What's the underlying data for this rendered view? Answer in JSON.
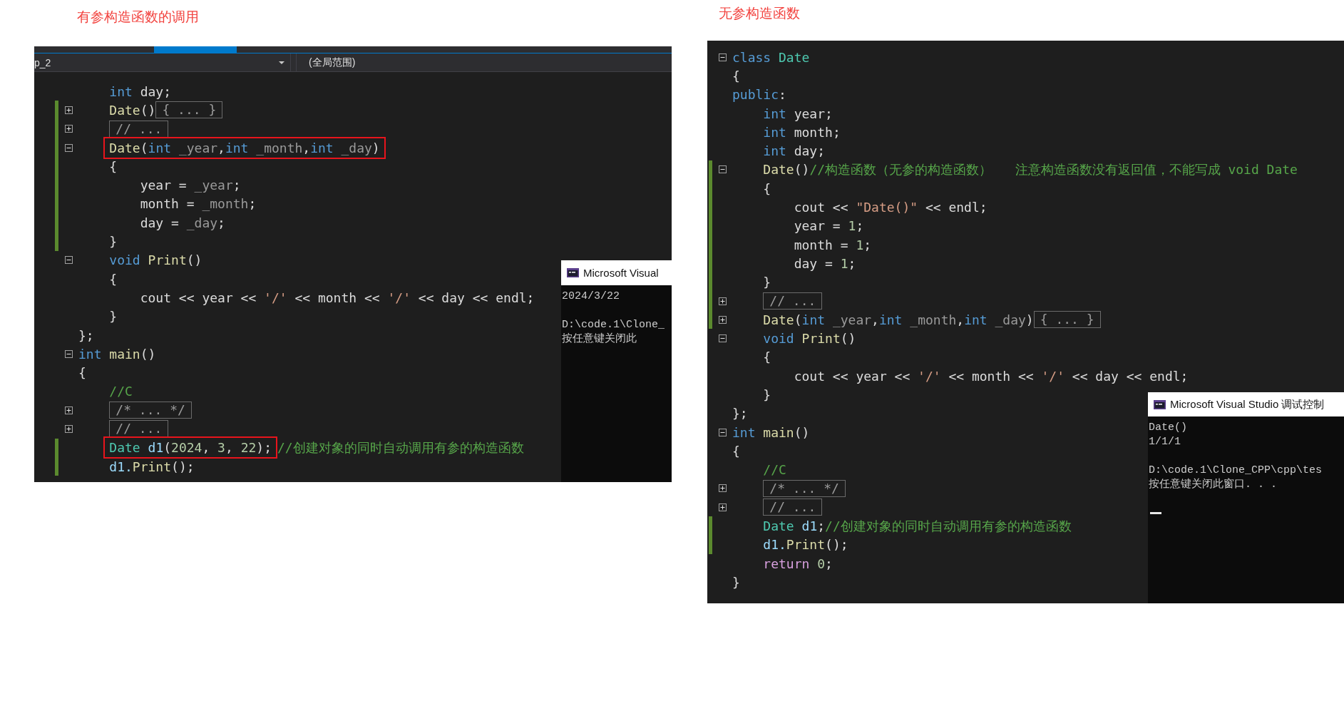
{
  "panels": [
    {
      "heading": "有参构造函数的调用",
      "nav": {
        "project": "p_2",
        "scope": "(全局范围)"
      },
      "lines": [
        {
          "changed": false,
          "parts": [
            {
              "kind": "indent"
            },
            {
              "kind": "code",
              "tokens": [
                {
                  "kind": "kw",
                  "text": "int"
                },
                {
                  "kind": "plain",
                  "text": " day;"
                }
              ]
            }
          ]
        },
        {
          "expanded": false,
          "changed": true,
          "parts": [
            {
              "kind": "indent"
            },
            {
              "kind": "code",
              "tokens": [
                {
                  "kind": "fn",
                  "text": "Date"
                },
                {
                  "kind": "plain",
                  "text": "()"
                }
              ]
            },
            {
              "kind": "fold",
              "text": "{ ... }"
            }
          ]
        },
        {
          "expanded": false,
          "changed": true,
          "parts": [
            {
              "kind": "indent"
            },
            {
              "kind": "fold",
              "text": "// ..."
            }
          ]
        },
        {
          "expanded": true,
          "changed": true,
          "parts": [
            {
              "kind": "indent"
            },
            {
              "kind": "marked",
              "tokens": [
                {
                  "kind": "fn",
                  "text": "Date"
                },
                {
                  "kind": "plain",
                  "text": "("
                },
                {
                  "kind": "kw",
                  "text": "int"
                },
                {
                  "kind": "param",
                  "text": " _year"
                },
                {
                  "kind": "plain",
                  "text": ","
                },
                {
                  "kind": "kw",
                  "text": "int"
                },
                {
                  "kind": "param",
                  "text": " _month"
                },
                {
                  "kind": "plain",
                  "text": ","
                },
                {
                  "kind": "kw",
                  "text": "int"
                },
                {
                  "kind": "param",
                  "text": " _day"
                },
                {
                  "kind": "plain",
                  "text": ")"
                }
              ]
            }
          ]
        },
        {
          "changed": true,
          "parts": [
            {
              "kind": "indent"
            },
            {
              "kind": "code",
              "tokens": [
                {
                  "kind": "plain",
                  "text": "{"
                }
              ]
            }
          ]
        },
        {
          "changed": true,
          "parts": [
            {
              "kind": "indent"
            },
            {
              "kind": "indent"
            },
            {
              "kind": "code",
              "tokens": [
                {
                  "kind": "plain",
                  "text": "year = "
                },
                {
                  "kind": "param",
                  "text": "_year"
                },
                {
                  "kind": "plain",
                  "text": ";"
                }
              ]
            }
          ]
        },
        {
          "changed": true,
          "parts": [
            {
              "kind": "indent"
            },
            {
              "kind": "indent"
            },
            {
              "kind": "code",
              "tokens": [
                {
                  "kind": "plain",
                  "text": "month = "
                },
                {
                  "kind": "param",
                  "text": "_month"
                },
                {
                  "kind": "plain",
                  "text": ";"
                }
              ]
            }
          ]
        },
        {
          "changed": true,
          "parts": [
            {
              "kind": "indent"
            },
            {
              "kind": "indent"
            },
            {
              "kind": "code",
              "tokens": [
                {
                  "kind": "plain",
                  "text": "day = "
                },
                {
                  "kind": "param",
                  "text": "_day"
                },
                {
                  "kind": "plain",
                  "text": ";"
                }
              ]
            }
          ]
        },
        {
          "changed": true,
          "parts": [
            {
              "kind": "indent"
            },
            {
              "kind": "code",
              "tokens": [
                {
                  "kind": "plain",
                  "text": "}"
                }
              ]
            }
          ]
        },
        {
          "expanded": true,
          "changed": false,
          "parts": [
            {
              "kind": "indent"
            },
            {
              "kind": "code",
              "tokens": [
                {
                  "kind": "kw",
                  "text": "void"
                },
                {
                  "kind": "fn",
                  "text": " Print"
                },
                {
                  "kind": "plain",
                  "text": "()"
                }
              ]
            }
          ]
        },
        {
          "changed": false,
          "parts": [
            {
              "kind": "indent"
            },
            {
              "kind": "code",
              "tokens": [
                {
                  "kind": "plain",
                  "text": "{"
                }
              ]
            }
          ]
        },
        {
          "changed": false,
          "parts": [
            {
              "kind": "indent"
            },
            {
              "kind": "indent"
            },
            {
              "kind": "code",
              "tokens": [
                {
                  "kind": "plain",
                  "text": "cout << year << "
                },
                {
                  "kind": "str",
                  "text": "'/'"
                },
                {
                  "kind": "plain",
                  "text": " << month << "
                },
                {
                  "kind": "str",
                  "text": "'/'"
                },
                {
                  "kind": "plain",
                  "text": " << day << endl;"
                }
              ]
            }
          ]
        },
        {
          "changed": false,
          "parts": [
            {
              "kind": "indent"
            },
            {
              "kind": "code",
              "tokens": [
                {
                  "kind": "plain",
                  "text": "}"
                }
              ]
            }
          ]
        },
        {
          "changed": false,
          "parts": [
            {
              "kind": "code",
              "tokens": [
                {
                  "kind": "plain",
                  "text": "};"
                }
              ]
            }
          ]
        },
        {
          "expanded": true,
          "changed": false,
          "parts": [
            {
              "kind": "code",
              "tokens": [
                {
                  "kind": "kw",
                  "text": "int"
                },
                {
                  "kind": "fn",
                  "text": " main"
                },
                {
                  "kind": "plain",
                  "text": "()"
                }
              ]
            }
          ]
        },
        {
          "changed": false,
          "parts": [
            {
              "kind": "code",
              "tokens": [
                {
                  "kind": "plain",
                  "text": "{"
                }
              ]
            }
          ]
        },
        {
          "changed": false,
          "parts": [
            {
              "kind": "indent"
            },
            {
              "kind": "code",
              "tokens": [
                {
                  "kind": "comment",
                  "text": "//C"
                }
              ]
            }
          ]
        },
        {
          "expanded": false,
          "changed": false,
          "parts": [
            {
              "kind": "indent"
            },
            {
              "kind": "fold",
              "text": "/* ... */"
            }
          ]
        },
        {
          "expanded": false,
          "changed": false,
          "parts": [
            {
              "kind": "indent"
            },
            {
              "kind": "fold",
              "text": "// ..."
            }
          ]
        },
        {
          "changed": true,
          "parts": [
            {
              "kind": "indent"
            },
            {
              "kind": "marked",
              "tokens": [
                {
                  "kind": "type",
                  "text": "Date"
                },
                {
                  "kind": "local",
                  "text": " d1"
                },
                {
                  "kind": "plain",
                  "text": "("
                },
                {
                  "kind": "num",
                  "text": "2024"
                },
                {
                  "kind": "plain",
                  "text": ", "
                },
                {
                  "kind": "num",
                  "text": "3"
                },
                {
                  "kind": "plain",
                  "text": ", "
                },
                {
                  "kind": "num",
                  "text": "22"
                },
                {
                  "kind": "plain",
                  "text": ");"
                }
              ]
            },
            {
              "kind": "code",
              "tokens": [
                {
                  "kind": "comment",
                  "text": "//创建对象的同时自动调用有参的构造函数"
                }
              ]
            }
          ]
        },
        {
          "changed": true,
          "parts": [
            {
              "kind": "indent"
            },
            {
              "kind": "code",
              "tokens": [
                {
                  "kind": "local",
                  "text": "d1."
                },
                {
                  "kind": "fn",
                  "text": "Print"
                },
                {
                  "kind": "plain",
                  "text": "();"
                }
              ]
            }
          ]
        }
      ],
      "console": {
        "title": "Microsoft Visual",
        "blocks": [
          [
            "2024/3/22"
          ],
          [
            "D:\\code.1\\Clone_",
            "按任意键关闭此"
          ]
        ],
        "cursor": false
      }
    },
    {
      "heading": "无参构造函数",
      "lines": [
        {
          "expanded": true,
          "changed": false,
          "parts": [
            {
              "kind": "code",
              "tokens": [
                {
                  "kind": "kw",
                  "text": "class"
                },
                {
                  "kind": "type",
                  "text": " Date"
                }
              ]
            }
          ]
        },
        {
          "changed": false,
          "parts": [
            {
              "kind": "code",
              "tokens": [
                {
                  "kind": "plain",
                  "text": "{"
                }
              ]
            }
          ]
        },
        {
          "changed": false,
          "parts": [
            {
              "kind": "code",
              "tokens": [
                {
                  "kind": "kw",
                  "text": "public"
                },
                {
                  "kind": "plain",
                  "text": ":"
                }
              ]
            }
          ]
        },
        {
          "changed": false,
          "parts": [
            {
              "kind": "indent"
            },
            {
              "kind": "code",
              "tokens": [
                {
                  "kind": "kw",
                  "text": "int"
                },
                {
                  "kind": "plain",
                  "text": " year;"
                }
              ]
            }
          ]
        },
        {
          "changed": false,
          "parts": [
            {
              "kind": "indent"
            },
            {
              "kind": "code",
              "tokens": [
                {
                  "kind": "kw",
                  "text": "int"
                },
                {
                  "kind": "plain",
                  "text": " month;"
                }
              ]
            }
          ]
        },
        {
          "changed": false,
          "parts": [
            {
              "kind": "indent"
            },
            {
              "kind": "code",
              "tokens": [
                {
                  "kind": "kw",
                  "text": "int"
                },
                {
                  "kind": "plain",
                  "text": " day;"
                }
              ]
            }
          ]
        },
        {
          "expanded": true,
          "changed": true,
          "parts": [
            {
              "kind": "indent"
            },
            {
              "kind": "code",
              "tokens": [
                {
                  "kind": "fn",
                  "text": "Date"
                },
                {
                  "kind": "plain",
                  "text": "()"
                },
                {
                  "kind": "comment",
                  "text": "//构造函数（无参的构造函数）   注意构造函数没有返回值，不能写成 void Date"
                }
              ]
            }
          ]
        },
        {
          "changed": true,
          "parts": [
            {
              "kind": "indent"
            },
            {
              "kind": "code",
              "tokens": [
                {
                  "kind": "plain",
                  "text": "{"
                }
              ]
            }
          ]
        },
        {
          "changed": true,
          "parts": [
            {
              "kind": "indent"
            },
            {
              "kind": "indent"
            },
            {
              "kind": "code",
              "tokens": [
                {
                  "kind": "plain",
                  "text": "cout << "
                },
                {
                  "kind": "str",
                  "text": "\"Date()\""
                },
                {
                  "kind": "plain",
                  "text": " << endl;"
                }
              ]
            }
          ]
        },
        {
          "changed": true,
          "parts": [
            {
              "kind": "indent"
            },
            {
              "kind": "indent"
            },
            {
              "kind": "code",
              "tokens": [
                {
                  "kind": "plain",
                  "text": "year = "
                },
                {
                  "kind": "num",
                  "text": "1"
                },
                {
                  "kind": "plain",
                  "text": ";"
                }
              ]
            }
          ]
        },
        {
          "changed": true,
          "parts": [
            {
              "kind": "indent"
            },
            {
              "kind": "indent"
            },
            {
              "kind": "code",
              "tokens": [
                {
                  "kind": "plain",
                  "text": "month = "
                },
                {
                  "kind": "num",
                  "text": "1"
                },
                {
                  "kind": "plain",
                  "text": ";"
                }
              ]
            }
          ]
        },
        {
          "changed": true,
          "parts": [
            {
              "kind": "indent"
            },
            {
              "kind": "indent"
            },
            {
              "kind": "code",
              "tokens": [
                {
                  "kind": "plain",
                  "text": "day = "
                },
                {
                  "kind": "num",
                  "text": "1"
                },
                {
                  "kind": "plain",
                  "text": ";"
                }
              ]
            }
          ]
        },
        {
          "changed": true,
          "parts": [
            {
              "kind": "indent"
            },
            {
              "kind": "code",
              "tokens": [
                {
                  "kind": "plain",
                  "text": "}"
                }
              ]
            }
          ]
        },
        {
          "expanded": false,
          "changed": true,
          "parts": [
            {
              "kind": "indent"
            },
            {
              "kind": "fold",
              "text": "// ..."
            }
          ]
        },
        {
          "expanded": false,
          "changed": true,
          "parts": [
            {
              "kind": "indent"
            },
            {
              "kind": "code",
              "tokens": [
                {
                  "kind": "fn",
                  "text": "Date"
                },
                {
                  "kind": "plain",
                  "text": "("
                },
                {
                  "kind": "kw",
                  "text": "int"
                },
                {
                  "kind": "param",
                  "text": " _year"
                },
                {
                  "kind": "plain",
                  "text": ","
                },
                {
                  "kind": "kw",
                  "text": "int"
                },
                {
                  "kind": "param",
                  "text": " _month"
                },
                {
                  "kind": "plain",
                  "text": ","
                },
                {
                  "kind": "kw",
                  "text": "int"
                },
                {
                  "kind": "param",
                  "text": " _day"
                },
                {
                  "kind": "plain",
                  "text": ")"
                }
              ]
            },
            {
              "kind": "fold",
              "text": "{ ... }"
            }
          ]
        },
        {
          "expanded": true,
          "changed": false,
          "parts": [
            {
              "kind": "indent"
            },
            {
              "kind": "code",
              "tokens": [
                {
                  "kind": "kw",
                  "text": "void"
                },
                {
                  "kind": "fn",
                  "text": " Print"
                },
                {
                  "kind": "plain",
                  "text": "()"
                }
              ]
            }
          ]
        },
        {
          "changed": false,
          "parts": [
            {
              "kind": "indent"
            },
            {
              "kind": "code",
              "tokens": [
                {
                  "kind": "plain",
                  "text": "{"
                }
              ]
            }
          ]
        },
        {
          "changed": false,
          "parts": [
            {
              "kind": "indent"
            },
            {
              "kind": "indent"
            },
            {
              "kind": "code",
              "tokens": [
                {
                  "kind": "plain",
                  "text": "cout << year << "
                },
                {
                  "kind": "str",
                  "text": "'/'"
                },
                {
                  "kind": "plain",
                  "text": " << month << "
                },
                {
                  "kind": "str",
                  "text": "'/'"
                },
                {
                  "kind": "plain",
                  "text": " << day << endl;"
                }
              ]
            }
          ]
        },
        {
          "changed": false,
          "parts": [
            {
              "kind": "indent"
            },
            {
              "kind": "code",
              "tokens": [
                {
                  "kind": "plain",
                  "text": "}"
                }
              ]
            }
          ]
        },
        {
          "changed": false,
          "parts": [
            {
              "kind": "code",
              "tokens": [
                {
                  "kind": "plain",
                  "text": "};"
                }
              ]
            }
          ]
        },
        {
          "expanded": true,
          "changed": false,
          "parts": [
            {
              "kind": "code",
              "tokens": [
                {
                  "kind": "kw",
                  "text": "int"
                },
                {
                  "kind": "fn",
                  "text": " main"
                },
                {
                  "kind": "plain",
                  "text": "()"
                }
              ]
            }
          ]
        },
        {
          "changed": false,
          "parts": [
            {
              "kind": "code",
              "tokens": [
                {
                  "kind": "plain",
                  "text": "{"
                }
              ]
            }
          ]
        },
        {
          "changed": false,
          "parts": [
            {
              "kind": "indent"
            },
            {
              "kind": "code",
              "tokens": [
                {
                  "kind": "comment",
                  "text": "//C"
                }
              ]
            }
          ]
        },
        {
          "expanded": false,
          "changed": false,
          "parts": [
            {
              "kind": "indent"
            },
            {
              "kind": "fold",
              "text": "/* ... */"
            }
          ]
        },
        {
          "expanded": false,
          "changed": false,
          "parts": [
            {
              "kind": "indent"
            },
            {
              "kind": "fold",
              "text": "// ..."
            }
          ]
        },
        {
          "changed": true,
          "parts": [
            {
              "kind": "indent"
            },
            {
              "kind": "code",
              "tokens": [
                {
                  "kind": "type",
                  "text": "Date"
                },
                {
                  "kind": "local",
                  "text": " d1"
                },
                {
                  "kind": "plain",
                  "text": ";"
                },
                {
                  "kind": "comment",
                  "text": "//创建对象的同时自动调用有参的构造函数"
                }
              ]
            }
          ]
        },
        {
          "changed": true,
          "parts": [
            {
              "kind": "indent"
            },
            {
              "kind": "code",
              "tokens": [
                {
                  "kind": "local",
                  "text": "d1."
                },
                {
                  "kind": "fn",
                  "text": "Print"
                },
                {
                  "kind": "plain",
                  "text": "();"
                }
              ]
            }
          ]
        },
        {
          "changed": false,
          "parts": [
            {
              "kind": "indent"
            },
            {
              "kind": "code",
              "tokens": [
                {
                  "kind": "ctrl",
                  "text": "return"
                },
                {
                  "kind": "num",
                  "text": " 0"
                },
                {
                  "kind": "plain",
                  "text": ";"
                }
              ]
            }
          ]
        },
        {
          "changed": false,
          "parts": [
            {
              "kind": "code",
              "tokens": [
                {
                  "kind": "plain",
                  "text": "}"
                }
              ]
            }
          ]
        }
      ],
      "console": {
        "title": "Microsoft Visual Studio 调试控制",
        "blocks": [
          [
            "Date()",
            "1/1/1"
          ],
          [
            "D:\\code.1\\Clone_CPP\\cpp\\tes",
            "按任意键关闭此窗口. . ."
          ]
        ],
        "cursor": true
      }
    }
  ]
}
